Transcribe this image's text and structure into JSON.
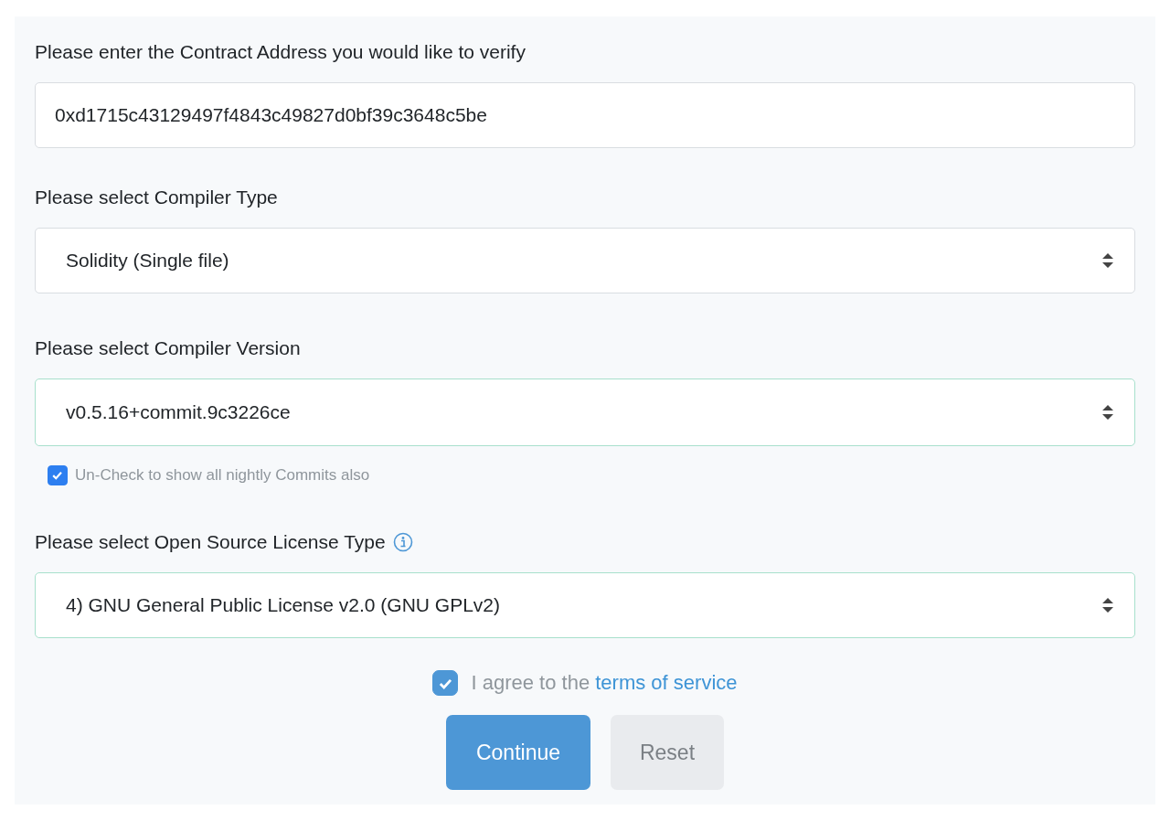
{
  "fields": [
    {
      "kind": "input",
      "label": "Please enter the Contract Address you would like to verify",
      "value": "0xd1715c43129497f4843c49827d0bf39c3648c5be",
      "validated": false
    },
    {
      "kind": "select",
      "label": "Please select Compiler Type",
      "value": "Solidity (Single file)",
      "validated": false
    },
    {
      "kind": "select",
      "label": "Please select Compiler Version",
      "value": "v0.5.16+commit.9c3226ce",
      "validated": true,
      "option": {
        "label": "Un-Check to show all nightly Commits also",
        "checked": true
      }
    },
    {
      "kind": "select",
      "label": "Please select Open Source License Type",
      "value": "4) GNU General Public License v2.0 (GNU GPLv2)",
      "validated": true,
      "info": true
    }
  ],
  "agreement": {
    "checked": true,
    "text": "I agree to the",
    "link": "terms of service"
  },
  "buttons": [
    {
      "label": "Continue",
      "kind": "primary"
    },
    {
      "label": "Reset",
      "kind": "secondary"
    }
  ]
}
